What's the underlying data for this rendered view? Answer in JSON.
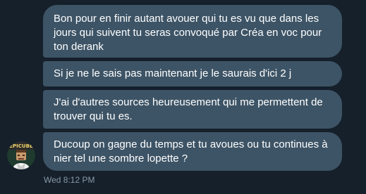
{
  "conversation": {
    "messages": [
      {
        "text": "Bon pour en finir autant avouer qui tu es vu que dans les jours qui suivent tu seras convoqué par Créa en voc pour ton derank"
      },
      {
        "text": "Si je ne le sais pas maintenant je le saurais d'ici 2 j"
      },
      {
        "text": "J'ai d'autres sources heureusement qui me permettent de trouver qui tu es."
      },
      {
        "text": "Ducoup on gagne du temps et tu avoues ou tu continues à nier tel une sombre lopette ?"
      }
    ],
    "avatar": {
      "label": "EPICUBE",
      "icon": "user-avatar-icon"
    },
    "timestamp": "Wed 8:12 PM"
  },
  "colors": {
    "background": "#15202b",
    "bubble": "#3d5466",
    "text": "#ffffff",
    "timestamp": "#8899a6"
  }
}
